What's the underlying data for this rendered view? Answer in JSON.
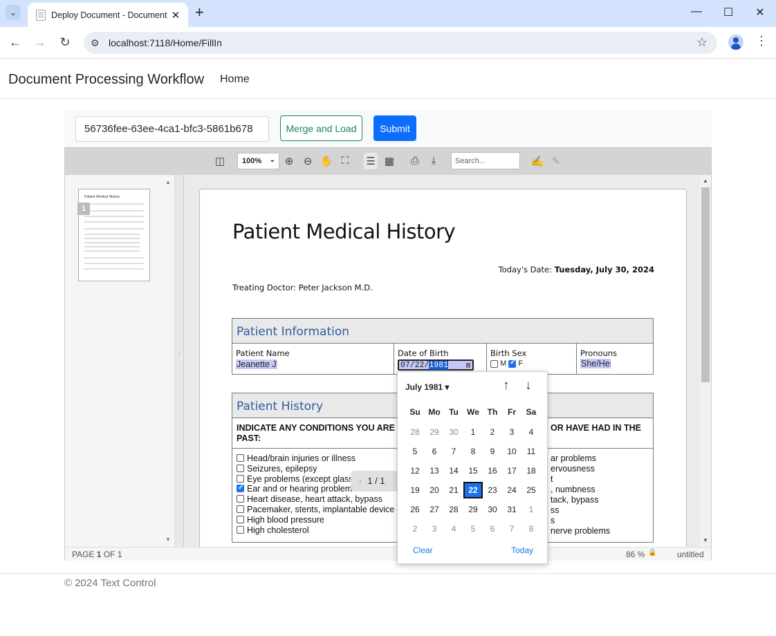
{
  "browser": {
    "tab_title": "Deploy Document - Document",
    "url": "localhost:7118/Home/FillIn"
  },
  "app": {
    "brand": "Document Processing Workflow",
    "nav_home": "Home"
  },
  "toolbar": {
    "doc_id_value": "56736fee-63ee-4ca1-bfc3-5861b678",
    "merge_label": "Merge and Load",
    "submit_label": "Submit"
  },
  "viewer": {
    "zoom": "100%",
    "search_placeholder": "Search...",
    "thumb_page_number": "1",
    "status_page_prefix": "PAGE ",
    "status_page_current": "1",
    "status_page_suffix": " OF 1",
    "status_zoom": "86 %",
    "status_doc_name": "untitled",
    "pager_text": "1 / 1"
  },
  "document": {
    "title": "Patient Medical History",
    "today_label": "Today's Date: ",
    "today_value": "Tuesday, July 30, 2024",
    "doctor_line": "Treating Doctor: Peter Jackson M.D.",
    "patient_info": {
      "header": "Patient Information",
      "name_label": "Patient Name",
      "name_value": "Jeanette J",
      "dob_label": "Date of Birth",
      "dob_month_day": "07/22/",
      "dob_year": "1981",
      "sex_label": "Birth Sex",
      "sex_m": "M",
      "sex_f": "F",
      "pronouns_label": "Pronouns",
      "pronouns_value": "She/Her"
    },
    "history": {
      "header": "Patient History",
      "indicate_left": "INDICATE ANY CONDITIONS YOU ARE",
      "indicate_left2": "PAST:",
      "indicate_right": "OR HAVE HAD IN THE",
      "conditions": [
        {
          "label": "Head/brain injuries or illness",
          "checked": false
        },
        {
          "label": "Seizures, epilepsy",
          "checked": false
        },
        {
          "label": "Eye problems (except glass",
          "checked": false
        },
        {
          "label": "Ear and or hearing problem",
          "checked": true
        },
        {
          "label": "Heart disease, heart attack, bypass",
          "checked": false
        },
        {
          "label": "Pacemaker, stents, implantable device",
          "checked": false
        },
        {
          "label": "High blood pressure",
          "checked": false
        },
        {
          "label": "High cholesterol",
          "checked": false
        }
      ],
      "right_fragments": [
        "ar problems",
        "ervousness",
        "t",
        ", numbness",
        "tack, bypass",
        "ss",
        "s",
        "nerve problems"
      ]
    }
  },
  "datepicker": {
    "month_label": "July 1981",
    "weekdays": [
      "Su",
      "Mo",
      "Tu",
      "We",
      "Th",
      "Fr",
      "Sa"
    ],
    "weeks": [
      [
        "28",
        "29",
        "30",
        "1",
        "2",
        "3",
        "4"
      ],
      [
        "5",
        "6",
        "7",
        "8",
        "9",
        "10",
        "11"
      ],
      [
        "12",
        "13",
        "14",
        "15",
        "16",
        "17",
        "18"
      ],
      [
        "19",
        "20",
        "21",
        "22",
        "23",
        "24",
        "25"
      ],
      [
        "26",
        "27",
        "28",
        "29",
        "30",
        "31",
        "1"
      ],
      [
        "2",
        "3",
        "4",
        "5",
        "6",
        "7",
        "8"
      ]
    ],
    "selected_day": "22",
    "clear_label": "Clear",
    "today_label": "Today"
  },
  "footer": {
    "copyright": "© 2024 Text Control"
  }
}
